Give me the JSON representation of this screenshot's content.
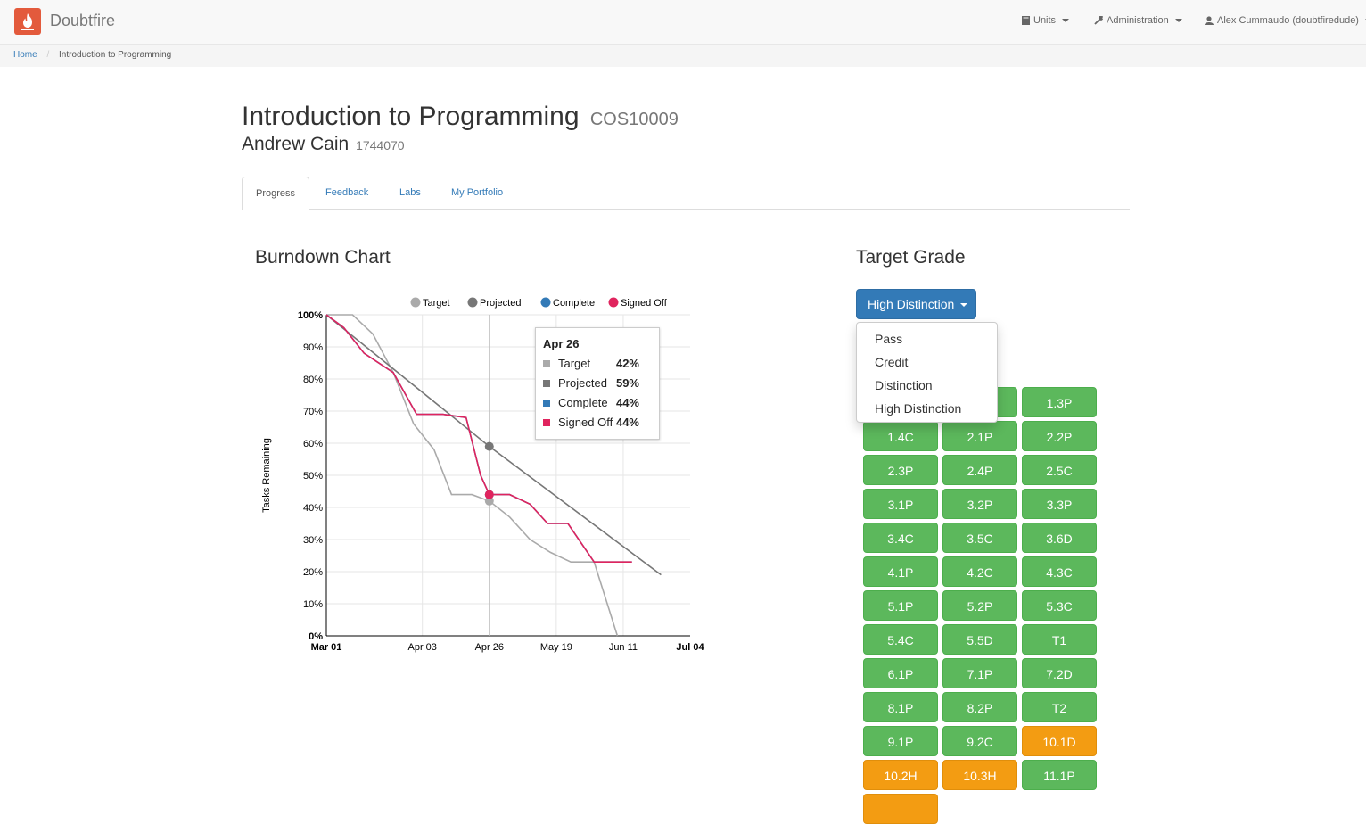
{
  "app": {
    "name": "Doubtfire"
  },
  "nav": {
    "units_label": "Units",
    "admin_label": "Administration",
    "user_label": "Alex Cummaudo (doubtfiredude)"
  },
  "breadcrumb": {
    "home": "Home",
    "current": "Introduction to Programming"
  },
  "unit": {
    "title": "Introduction to Programming",
    "code": "COS10009"
  },
  "student": {
    "name": "Andrew Cain",
    "id": "1744070"
  },
  "tabs": [
    {
      "label": "Progress",
      "active": true
    },
    {
      "label": "Feedback",
      "active": false
    },
    {
      "label": "Labs",
      "active": false
    },
    {
      "label": "My Portfolio",
      "active": false
    }
  ],
  "burndown": {
    "title": "Burndown Chart",
    "tooltip": {
      "date": "Apr 26",
      "rows": [
        {
          "name": "Target",
          "value": "42%",
          "color": "#aaaaaa"
        },
        {
          "name": "Projected",
          "value": "59%",
          "color": "#777777"
        },
        {
          "name": "Complete",
          "value": "44%",
          "color": "#337ab7"
        },
        {
          "name": "Signed Off",
          "value": "44%",
          "color": "#e0245e"
        }
      ]
    }
  },
  "chart_data": {
    "type": "line",
    "title": "",
    "xlabel": "",
    "ylabel": "Tasks Remaining",
    "x_ticks": [
      "Mar 01",
      "Apr 03",
      "Apr 26",
      "May 19",
      "Jun 11",
      "Jul 04"
    ],
    "y_ticks": [
      "0%",
      "10%",
      "20%",
      "30%",
      "40%",
      "50%",
      "60%",
      "70%",
      "80%",
      "90%",
      "100%"
    ],
    "ylim": [
      0,
      100
    ],
    "legend": [
      "Target",
      "Projected",
      "Complete",
      "Signed Off"
    ],
    "legend_position": "top",
    "grid": true,
    "highlight_date": "Apr 26",
    "series": [
      {
        "name": "Target",
        "color": "#aaaaaa",
        "points": [
          [
            "03-01",
            100
          ],
          [
            "03-10",
            100
          ],
          [
            "03-17",
            94
          ],
          [
            "03-24",
            82
          ],
          [
            "03-31",
            66
          ],
          [
            "04-07",
            58
          ],
          [
            "04-13",
            44
          ],
          [
            "04-20",
            44
          ],
          [
            "04-26",
            42
          ],
          [
            "05-03",
            37
          ],
          [
            "05-10",
            30
          ],
          [
            "05-17",
            26
          ],
          [
            "05-24",
            23
          ],
          [
            "06-01",
            23
          ],
          [
            "06-09",
            0
          ]
        ]
      },
      {
        "name": "Projected",
        "color": "#777777",
        "points": [
          [
            "03-01",
            100
          ],
          [
            "04-26",
            59
          ],
          [
            "06-24",
            19
          ]
        ]
      },
      {
        "name": "Complete",
        "color": "#337ab7",
        "points": [
          [
            "03-01",
            100
          ],
          [
            "03-07",
            96
          ],
          [
            "03-14",
            88
          ],
          [
            "03-24",
            82
          ],
          [
            "04-01",
            69
          ],
          [
            "04-10",
            69
          ],
          [
            "04-18",
            68
          ],
          [
            "04-23",
            50
          ],
          [
            "04-26",
            44
          ],
          [
            "05-03",
            44
          ],
          [
            "05-10",
            41
          ],
          [
            "05-16",
            35
          ],
          [
            "05-23",
            35
          ],
          [
            "06-01",
            23
          ],
          [
            "06-14",
            23
          ]
        ]
      },
      {
        "name": "Signed Off",
        "color": "#e0245e",
        "points": [
          [
            "03-01",
            100
          ],
          [
            "03-07",
            96
          ],
          [
            "03-14",
            88
          ],
          [
            "03-24",
            82
          ],
          [
            "04-01",
            69
          ],
          [
            "04-10",
            69
          ],
          [
            "04-18",
            68
          ],
          [
            "04-23",
            50
          ],
          [
            "04-26",
            44
          ],
          [
            "05-03",
            44
          ],
          [
            "05-10",
            41
          ],
          [
            "05-16",
            35
          ],
          [
            "05-23",
            35
          ],
          [
            "06-01",
            23
          ],
          [
            "06-14",
            23
          ]
        ]
      }
    ]
  },
  "target_grade": {
    "title": "Target Grade",
    "selected": "High Distinction",
    "options": [
      "Pass",
      "Credit",
      "Distinction",
      "High Distinction"
    ]
  },
  "tasks": [
    {
      "label": "1.3P",
      "status": "green"
    },
    {
      "label": "1.4C",
      "status": "green"
    },
    {
      "label": "2.1P",
      "status": "green"
    },
    {
      "label": "2.2P",
      "status": "green"
    },
    {
      "label": "2.3P",
      "status": "green"
    },
    {
      "label": "2.4P",
      "status": "green"
    },
    {
      "label": "2.5C",
      "status": "green"
    },
    {
      "label": "3.1P",
      "status": "green"
    },
    {
      "label": "3.2P",
      "status": "green"
    },
    {
      "label": "3.3P",
      "status": "green"
    },
    {
      "label": "3.4C",
      "status": "green"
    },
    {
      "label": "3.5C",
      "status": "green"
    },
    {
      "label": "3.6D",
      "status": "green"
    },
    {
      "label": "4.1P",
      "status": "green"
    },
    {
      "label": "4.2C",
      "status": "green"
    },
    {
      "label": "4.3C",
      "status": "green"
    },
    {
      "label": "5.1P",
      "status": "green"
    },
    {
      "label": "5.2P",
      "status": "green"
    },
    {
      "label": "5.3C",
      "status": "green"
    },
    {
      "label": "5.4C",
      "status": "green"
    },
    {
      "label": "5.5D",
      "status": "green"
    },
    {
      "label": "T1",
      "status": "green"
    },
    {
      "label": "6.1P",
      "status": "green"
    },
    {
      "label": "7.1P",
      "status": "green"
    },
    {
      "label": "7.2D",
      "status": "green"
    },
    {
      "label": "8.1P",
      "status": "green"
    },
    {
      "label": "8.2P",
      "status": "green"
    },
    {
      "label": "T2",
      "status": "green"
    },
    {
      "label": "9.1P",
      "status": "green"
    },
    {
      "label": "9.2C",
      "status": "green"
    },
    {
      "label": "10.1D",
      "status": "orange-dark"
    },
    {
      "label": "10.2H",
      "status": "orange-dark"
    },
    {
      "label": "10.3H",
      "status": "orange-dark"
    },
    {
      "label": "11.1P",
      "status": "green"
    }
  ]
}
